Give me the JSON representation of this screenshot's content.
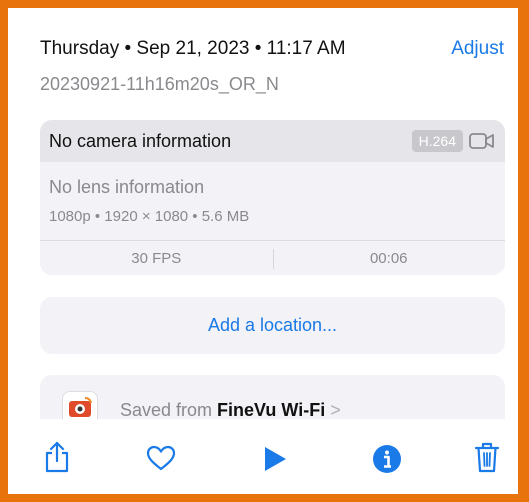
{
  "header": {
    "datetime": "Thursday • Sep 21, 2023 • 11:17 AM",
    "adjust_label": "Adjust",
    "filename": "20230921-11h16m20s_OR_N"
  },
  "camera": {
    "title": "No camera information",
    "codec": "H.264",
    "lens": "No lens information",
    "specs": "1080p • 1920 × 1080 • 5.6 MB",
    "fps": "30 FPS",
    "duration": "00:06"
  },
  "location": {
    "label": "Add a location..."
  },
  "saved": {
    "prefix": "Saved from ",
    "app": "FineVu Wi-Fi",
    "chevron": ">"
  },
  "toolbar": {
    "icons": [
      "share-icon",
      "heart-icon",
      "play-icon",
      "info-icon",
      "trash-icon"
    ]
  },
  "colors": {
    "accent": "#1a7ae8",
    "border": "#e8720c",
    "card": "#f2f2f7"
  }
}
